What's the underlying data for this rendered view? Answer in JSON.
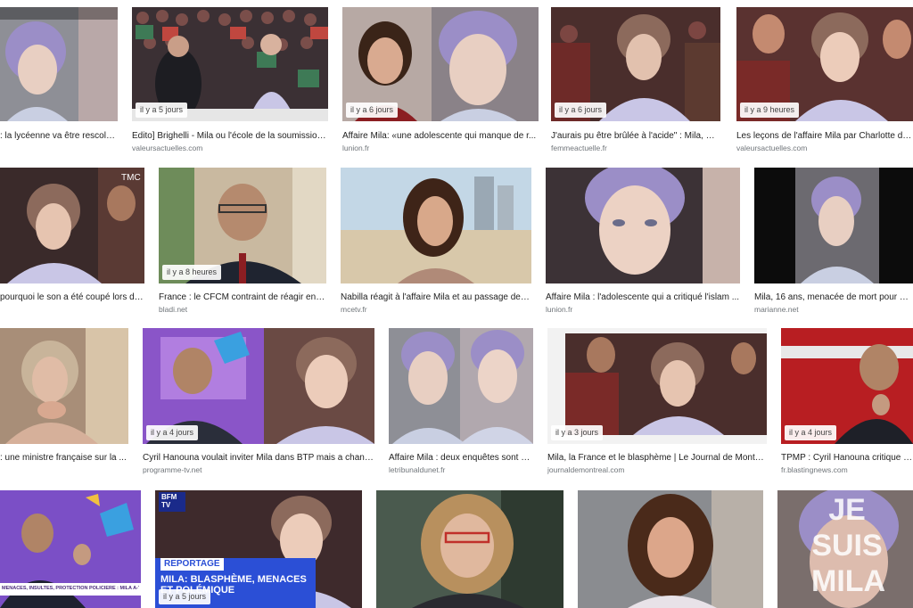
{
  "results": [
    {
      "age": "",
      "title": ": la lycéenne va être rescola...",
      "domain": "",
      "image": "girl-purple-hair-video"
    },
    {
      "age": "il y a 5 jours",
      "title": "Edito] Brighelli - Mila ou l'école de la soumission ...",
      "domain": "valeursactuelles.com",
      "image": "tv-studio-audience"
    },
    {
      "age": "il y a 6 jours",
      "title": "Affaire Mila: «une adolescente qui manque de r...",
      "domain": "lunion.fr",
      "image": "woman-and-girl-split"
    },
    {
      "age": "il y a 6 jours",
      "title": "J'aurais pu être brûlée à l'acide\" : Mila, me...",
      "domain": "femmeactuelle.fr",
      "image": "girl-hoodie-tv-set"
    },
    {
      "age": "il y a 9 heures",
      "title": "Les leçons de l'affaire Mila par Charlotte d'Orn...",
      "domain": "valeursactuelles.com",
      "image": "girl-hoodie-tv-set"
    },
    {
      "age": "",
      "title": "pourquoi le son a été coupé lors de ...",
      "domain": "",
      "image": "girl-hoodie-tmc",
      "badge": "TMC"
    },
    {
      "age": "il y a 8 heures",
      "title": "France : le CFCM contraint de réagir enc...",
      "domain": "bladi.net",
      "image": "man-glasses-suit"
    },
    {
      "age": "",
      "title": "Nabilla réagit à l'affaire Mila et au passage de l...",
      "domain": "mcetv.fr",
      "image": "woman-beach"
    },
    {
      "age": "",
      "title": "Affaire Mila : l'adolescente qui a critiqué l'islam ...",
      "domain": "lunion.fr",
      "image": "girl-purple-hair-close"
    },
    {
      "age": "",
      "title": "Mila, 16 ans, menacée de mort pour avoi...",
      "domain": "marianne.net",
      "image": "girl-video-dark"
    },
    {
      "age": "",
      "title": ": une ministre française sur la ...",
      "domain": "",
      "image": "older-woman"
    },
    {
      "age": "il y a 4 jours",
      "title": "Cyril Hanouna voulait inviter Mila dans BTP mais a chang...",
      "domain": "programme-tv.net",
      "image": "host-and-girl"
    },
    {
      "age": "",
      "title": "Affaire Mila : deux enquêtes sont o...",
      "domain": "letribunaldunet.fr",
      "image": "girl-double-video"
    },
    {
      "age": "il y a 3 jours",
      "title": "Mila, la France et le blasphème | Le Journal de Montréal",
      "domain": "journaldemontreal.com",
      "image": "girl-hoodie-tv-set"
    },
    {
      "age": "il y a 4 jours",
      "title": "TPMP : Cyril Hanouna critique Mila",
      "domain": "fr.blastingnews.com",
      "image": "host-red-set"
    },
    {
      "age": "",
      "title": "",
      "domain": "",
      "image": "host-purple-set",
      "ticker": "MENACES, INSULTES, PROTECTION POLICIÈRE : MILA A-T-ELLE DU RAISON DE S'EXPRIMER ?"
    },
    {
      "age": "il y a 5 jours",
      "title": "",
      "domain": "",
      "image": "bfmtv-reportage",
      "channel": "BFM TV",
      "tag": "REPORTAGE",
      "headline": "MILA: BLASPHÈME, MENACES ET POLÉMIQUE"
    },
    {
      "age": "",
      "title": "",
      "domain": "",
      "image": "woman-red-glasses"
    },
    {
      "age": "",
      "title": "",
      "domain": "",
      "image": "woman-brown-hair"
    },
    {
      "age": "",
      "title": "",
      "domain": "",
      "image": "je-suis-mila",
      "slogan": "JE SUIS MILA"
    }
  ],
  "colors": {
    "title_text": "#222222",
    "domain_text": "#70757a",
    "badge_bg": "#ffffff",
    "purple_hair": "#9b8ec7",
    "hoodie": "#c9c6e6",
    "tv_purple": "#8a55c8",
    "bfm_blue": "#2b4fd6"
  }
}
